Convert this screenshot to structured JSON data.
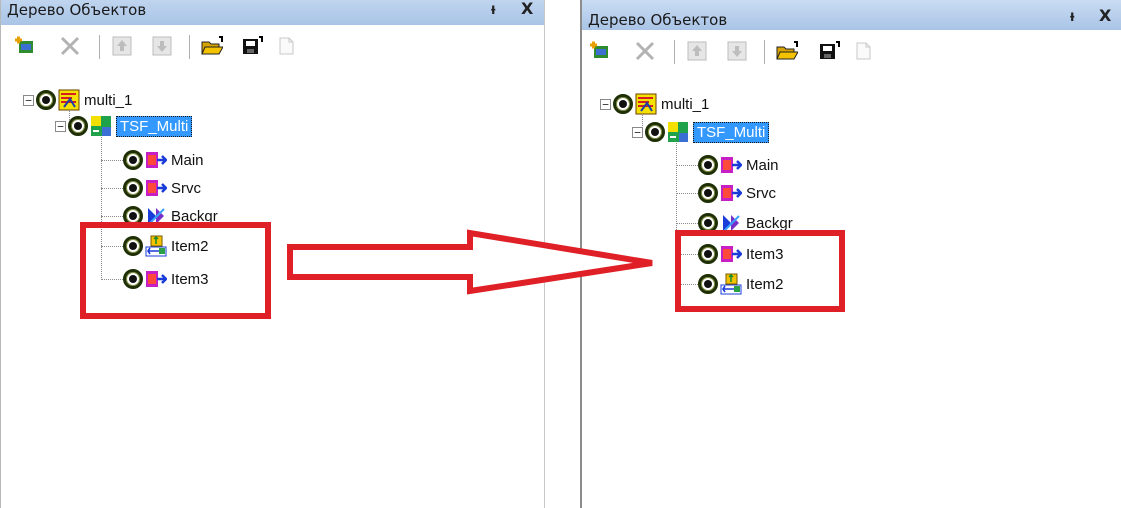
{
  "left_panel": {
    "title": "Дерево Объектов",
    "pin_glyph": "ᵼ",
    "close_glyph": "X",
    "tree": {
      "root": "multi_1",
      "child": "TSF_Multi",
      "items": [
        "Main",
        "Srvc",
        "Backgr",
        "Item2",
        "Item3"
      ]
    }
  },
  "right_panel": {
    "title": "Дерево Объектов",
    "pin_glyph": "ᵼ",
    "close_glyph": "X",
    "tree": {
      "root": "multi_1",
      "child": "TSF_Multi",
      "items": [
        "Main",
        "Srvc",
        "Backgr",
        "Item3",
        "Item2"
      ]
    }
  },
  "toolbar_icons": [
    "add-object-icon",
    "delete-icon",
    "move-up-icon",
    "move-down-icon",
    "open-folder-icon",
    "save-icon",
    "new-page-icon"
  ],
  "colors": {
    "highlight_box": "#e02027",
    "selection": "#3399ff",
    "titlebar": "#b9d1ee"
  }
}
